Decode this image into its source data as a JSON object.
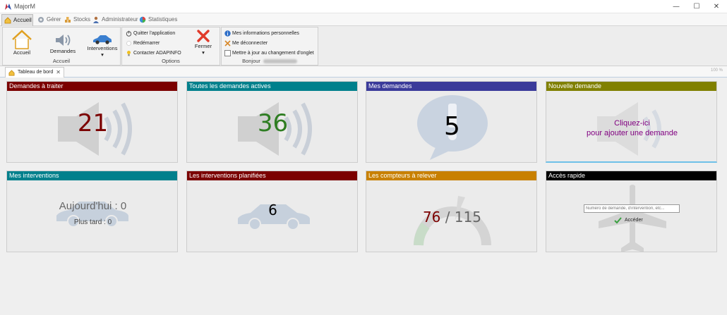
{
  "window": {
    "title": "MajorM",
    "minimize": "—",
    "maximize": "☐",
    "close": "✕"
  },
  "menu": {
    "tabs": [
      {
        "label": "Accueil"
      },
      {
        "label": "Gérer"
      },
      {
        "label": "Stocks"
      },
      {
        "label": "Administrateur"
      },
      {
        "label": "Statistiques"
      }
    ]
  },
  "ribbon": {
    "group1": {
      "accueil": "Accueil",
      "demandes": "Demandes",
      "interventions": "Interventions",
      "dropdown": "▾",
      "label": "Accueil"
    },
    "group2": {
      "quitter": "Quitter l'application",
      "redemarrer": "Redémarrer",
      "contacter": "Contacter ADAPINFO",
      "fermer": "Fermer",
      "dropdown": "▾",
      "label": "Options"
    },
    "group3": {
      "infos": "Mes informations personnelles",
      "deconnecter": "Me déconnecter",
      "maj": "Mettre à jour au changement d'onglet",
      "bonjour": "Bonjour"
    }
  },
  "doctab": {
    "label": "Tableau de bord",
    "close": "✕",
    "zoom": "100 %"
  },
  "tiles": {
    "demandes_traiter": {
      "title": "Demandes à traiter",
      "value": "21"
    },
    "toutes_demandes": {
      "title": "Toutes les demandes actives",
      "value": "36"
    },
    "mes_demandes": {
      "title": "Mes demandes",
      "value": "5"
    },
    "nouvelle_demande": {
      "title": "Nouvelle demande",
      "line1": "Cliquez-ici",
      "line2": "pour ajouter une demande"
    },
    "mes_interventions": {
      "title": "Mes interventions",
      "today": "Aujourd'hui : 0",
      "later": "Plus tard : 0"
    },
    "interventions_planifiees": {
      "title": "Les interventions planifiées",
      "value": "6"
    },
    "compteurs": {
      "title": "Les compteurs à relever",
      "current": "76",
      "separator": "/",
      "total": "115"
    },
    "acces_rapide": {
      "title": "Accès rapide",
      "placeholder": "Numéro de demande, d'intervention, etc...",
      "button": "Accéder"
    }
  },
  "colors": {
    "dark_red": "#7b0000",
    "teal": "#00808c",
    "indigo": "#3a3a9a",
    "olive": "#808000",
    "orange": "#c88000",
    "black": "#000000",
    "purple": "#800080",
    "green": "#2e7d22"
  }
}
